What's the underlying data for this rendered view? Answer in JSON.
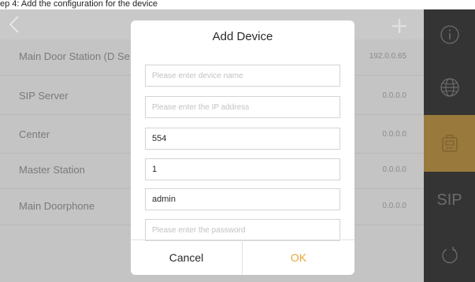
{
  "caption": {
    "text": "ep 4: Add the configuration for the device"
  },
  "device_list": {
    "items": [
      {
        "name": "Main Door Station (D Se",
        "ip": "192.0.0.65"
      },
      {
        "name": "SIP Server",
        "ip": "0.0.0.0"
      },
      {
        "name": "Center",
        "ip": "0.0.0.0"
      },
      {
        "name": "Master Station",
        "ip": "0.0.0.0"
      },
      {
        "name": "Main Doorphone",
        "ip": "0.0.0.0"
      }
    ]
  },
  "rail": {
    "sip_label": "SIP",
    "accent_color": "#9a7a3c"
  },
  "modal": {
    "title": "Add Device",
    "fields": {
      "device_name_placeholder": "Please enter device name",
      "ip_placeholder": "Please enter the IP address",
      "port_value": "554",
      "channel_value": "1",
      "username_value": "admin",
      "password_placeholder": "Please enter the password"
    },
    "cancel_label": "Cancel",
    "ok_label": "OK",
    "ok_color": "#e6a63a"
  },
  "icons": {
    "back": "chevron-left-icon",
    "add": "plus-icon",
    "info": "info-icon",
    "network": "globe-icon",
    "device": "intercom-device-icon",
    "restart": "power-refresh-icon"
  }
}
